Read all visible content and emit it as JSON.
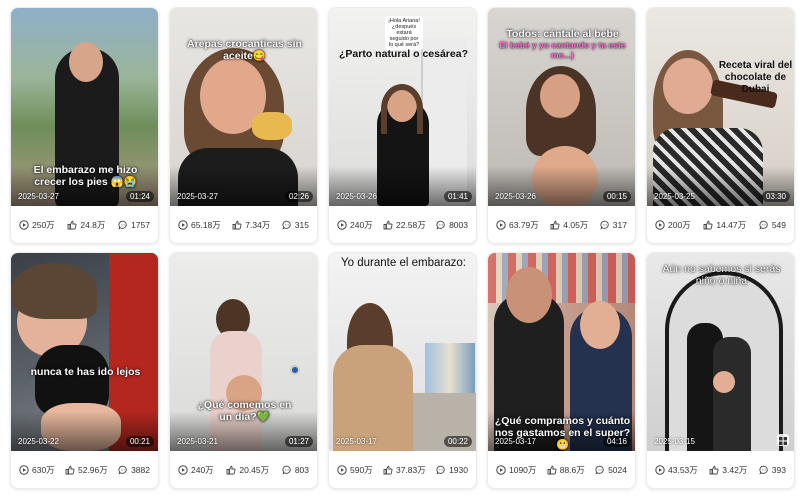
{
  "cards": [
    {
      "caption": "El embarazo me hizo crecer los pies 😱😭",
      "date": "2025-03-27",
      "duration": "01:24",
      "views": "250万",
      "likes": "24.8万",
      "comments": "1757"
    },
    {
      "caption": "Arepas crocanticas sin aceite😋",
      "date": "2025-03-27",
      "duration": "02:26",
      "views": "65.18万",
      "likes": "7.34万",
      "comments": "315"
    },
    {
      "caption": "¿Parto natural o cesárea?",
      "sticker": "¡Hola Ariana! ¿después estará seguido por lo qué será?",
      "date": "2025-03-26",
      "duration": "01:41",
      "views": "240万",
      "likes": "22.58万",
      "comments": "8003"
    },
    {
      "caption": "Todos: cántale al bebe",
      "caption2": "El bebé y yo cantando y ta este mo...)",
      "date": "2025-03-26",
      "duration": "00:15",
      "views": "63.79万",
      "likes": "4.05万",
      "comments": "317"
    },
    {
      "caption": "Receta viral del chocolate de Dubai",
      "date": "2025-03-25",
      "duration": "03:30",
      "views": "200万",
      "likes": "14.47万",
      "comments": "549"
    },
    {
      "caption": "nunca te has ido lejos",
      "date": "2025-03-22",
      "duration": "00:21",
      "views": "630万",
      "likes": "52.96万",
      "comments": "3882"
    },
    {
      "caption": "¿Qué comemos en un día?💚",
      "date": "2025-03-21",
      "duration": "01:27",
      "views": "240万",
      "likes": "20.45万",
      "comments": "803"
    },
    {
      "caption": "Yo durante el embarazo:",
      "date": "2025-03-17",
      "duration": "00:22",
      "views": "590万",
      "likes": "37.83万",
      "comments": "1930"
    },
    {
      "caption": "¿Qué compramos y cuánto nos gastamos en el super?😬",
      "date": "2025-03-17",
      "duration": "04:16",
      "views": "1090万",
      "likes": "88.6万",
      "comments": "5024"
    },
    {
      "caption": "Aún no sabemos si serás niño o niña",
      "date": "2025-03-15",
      "duration": "",
      "views": "43.53万",
      "likes": "3.42万",
      "comments": "393"
    }
  ],
  "icons": {
    "views": "play-circle-icon",
    "likes": "thumbs-up-icon",
    "comments": "comment-icon"
  }
}
